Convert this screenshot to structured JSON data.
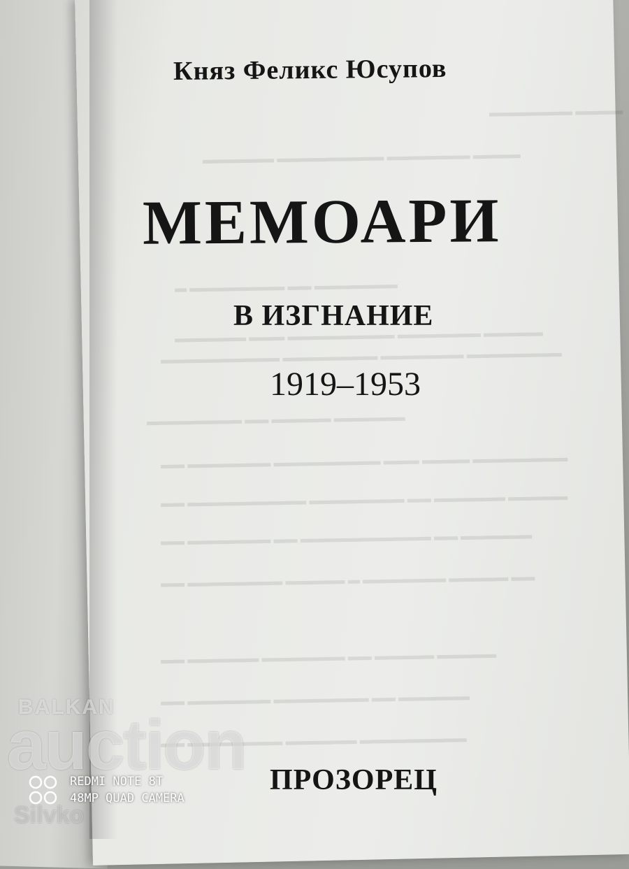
{
  "book": {
    "author": "Княз Феликс Юсупов",
    "title": "МЕМОАРИ",
    "subtitle": "В ИЗГНАНИЕ",
    "years": "1919–1953",
    "publisher": "ПРОЗОРЕЦ"
  },
  "watermark": {
    "brand_top": "BALKAN",
    "brand_main": "auction",
    "brand_sub": "Silvko"
  },
  "camera_stamp": {
    "model": "REDMI NOTE 8T",
    "camera": "48MP QUAD CAMERA",
    "icon": "quad-camera-icon"
  },
  "colors": {
    "ink": "#151515",
    "paper": "#ecedea",
    "watermark": "#ffffff"
  }
}
